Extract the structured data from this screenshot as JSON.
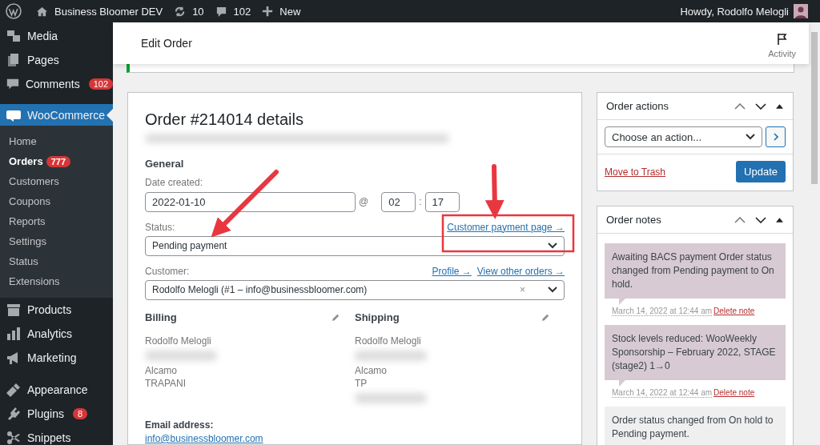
{
  "admin_bar": {
    "site_name": "Business Bloomer DEV",
    "updates": "10",
    "comments": "102",
    "new_label": "New",
    "greeting": "Howdy, Rodolfo Melogli"
  },
  "sidebar": {
    "items": [
      {
        "label": "Media",
        "selected": false
      },
      {
        "label": "Pages",
        "selected": false
      },
      {
        "label": "Comments",
        "badge": "102",
        "selected": false
      },
      {
        "label": "WooCommerce",
        "selected": true,
        "children": [
          {
            "label": "Home",
            "selected": false
          },
          {
            "label": "Orders",
            "badge": "777",
            "selected": true
          },
          {
            "label": "Customers",
            "selected": false
          },
          {
            "label": "Coupons",
            "selected": false
          },
          {
            "label": "Reports",
            "selected": false
          },
          {
            "label": "Settings",
            "selected": false
          },
          {
            "label": "Status",
            "selected": false
          },
          {
            "label": "Extensions",
            "selected": false
          }
        ]
      },
      {
        "label": "Products",
        "selected": false
      },
      {
        "label": "Analytics",
        "selected": false
      },
      {
        "label": "Marketing",
        "selected": false
      },
      {
        "label": "Appearance",
        "selected": false
      },
      {
        "label": "Plugins",
        "badge": "8",
        "selected": false
      },
      {
        "label": "Snippets",
        "selected": false
      }
    ]
  },
  "header": {
    "title": "Edit Order",
    "activity": "Activity"
  },
  "order": {
    "title": "Order #214014 details",
    "general_heading": "General",
    "date_label": "Date created:",
    "date": "2022-01-10",
    "at": "@",
    "hour": "02",
    "colon": ":",
    "minute": "17",
    "status_label": "Status:",
    "payment_link": "Customer payment page →",
    "status": "Pending payment",
    "customer_label": "Customer:",
    "profile_link": "Profile →",
    "orders_link": "View other orders →",
    "customer": "Rodolfo Melogli (#1 – info@businessbloomer.com)",
    "clear": "×",
    "billing": {
      "heading": "Billing",
      "lines": [
        {
          "kind": "text",
          "text": "Rodolfo Melogli"
        },
        {
          "kind": "blurred"
        },
        {
          "kind": "text",
          "text": "Alcamo"
        },
        {
          "kind": "text",
          "text": "TRAPANI"
        }
      ]
    },
    "shipping": {
      "heading": "Shipping",
      "lines": [
        {
          "kind": "text",
          "text": "Rodolfo Melogli"
        },
        {
          "kind": "blurred"
        },
        {
          "kind": "text",
          "text": "Alcamo"
        },
        {
          "kind": "text",
          "text": "TP"
        },
        {
          "kind": "blurred"
        }
      ]
    },
    "email_label": "Email address:",
    "email": "info@businessbloomer.com"
  },
  "order_actions": {
    "title": "Order actions",
    "action_placeholder": "Choose an action...",
    "trash": "Move to Trash",
    "update": "Update"
  },
  "order_notes": {
    "title": "Order notes",
    "notes": [
      {
        "kind": "system",
        "text": "Awaiting BACS payment Order status changed from Pending payment to On hold.",
        "date": "March 14, 2022 at 12:44 am",
        "delete": "Delete note"
      },
      {
        "kind": "system",
        "text": "Stock levels reduced: WooWeekly Sponsorship – February 2022, STAGE (stage2) 1→0",
        "date": "March 14, 2022 at 12:44 am",
        "delete": "Delete note"
      },
      {
        "kind": "private",
        "text": "Order status changed from On hold to Pending payment."
      }
    ]
  }
}
